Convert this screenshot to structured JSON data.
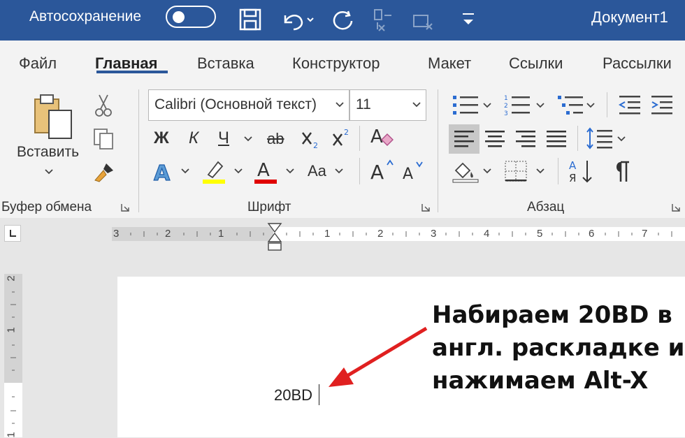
{
  "titlebar": {
    "autosave_label": "Автосохранение",
    "doc_title": "Документ1",
    "bg_color": "#2b579a"
  },
  "tabs": [
    {
      "label": "Файл"
    },
    {
      "label": "Главная"
    },
    {
      "label": "Вставка"
    },
    {
      "label": "Конструктор"
    },
    {
      "label": "Макет"
    },
    {
      "label": "Ссылки"
    },
    {
      "label": "Рассылки"
    }
  ],
  "clipboard": {
    "paste_label": "Вставить",
    "group_label": "Буфер обмена"
  },
  "font": {
    "name_value": "Calibri (Основной текст)",
    "size_value": "11",
    "group_label": "Шрифт",
    "bold": "Ж",
    "italic": "К",
    "underline": "Ч",
    "strike": "ab",
    "case": "Aa",
    "highlight_color": "#ffff00",
    "font_color": "#e00000"
  },
  "paragraph": {
    "group_label": "Абзац"
  },
  "ruler": {
    "labels": [
      "3",
      "2",
      "1",
      "1",
      "2",
      "3",
      "4",
      "5",
      "6",
      "7"
    ],
    "vlabels": [
      "2",
      "1",
      "1"
    ]
  },
  "document": {
    "typed_text": "20BD"
  },
  "annotation": {
    "lines": [
      "Набираем 20BD в",
      "англ. раскладке и",
      "нажимаем Alt-X"
    ],
    "arrow_color": "#e02020"
  }
}
